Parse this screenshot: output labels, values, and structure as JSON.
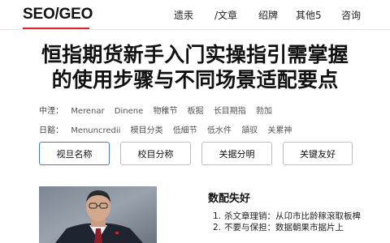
{
  "header": {
    "logo": "SEO/GEO",
    "nav": [
      "遗汞",
      "/文章",
      "绍牌",
      "其他5",
      "咨询"
    ]
  },
  "article": {
    "title_line1": "恒指期货新手入门实操指引需掌握",
    "title_line2": "的使用步骤与不同场景适配要点"
  },
  "meta": {
    "row1_label": "中湮：",
    "row1_values": [
      "Merenar",
      "Dinene",
      "物稚节",
      "板掘",
      "长目期指",
      "勃加"
    ],
    "row2_label": "日豁：",
    "row2_values": [
      "Menuncredii",
      "模目分类",
      "低細节",
      "低水件",
      "頷驭",
      "关累神"
    ]
  },
  "buttons": [
    "视旦名称",
    "校目分称",
    "关据分明",
    "关键友好"
  ],
  "sidebar": {
    "title": "数配失好",
    "items": [
      {
        "num": "1.",
        "text": "杀文章理销：从卬市比龄稼滾取板椑"
      },
      {
        "num": "2.",
        "text": "不要与保担：数据朝果市据片上"
      }
    ]
  },
  "colors": {
    "accent": "#d9232e",
    "active_border": "#4a77c8"
  }
}
